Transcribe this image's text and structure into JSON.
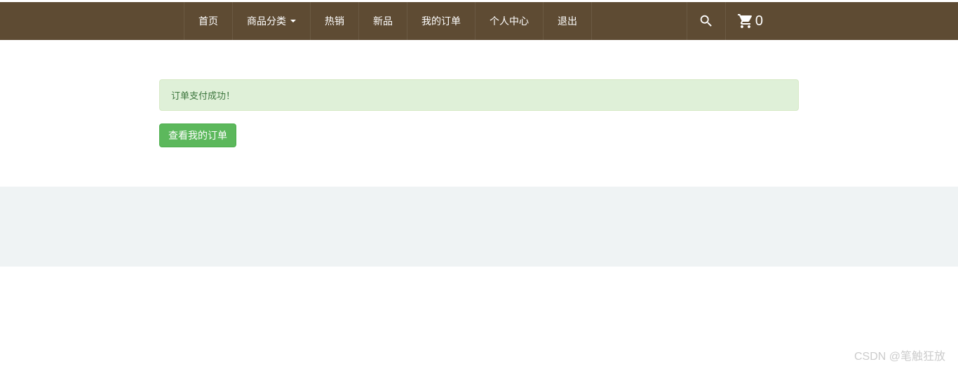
{
  "nav": {
    "items": [
      {
        "label": "首页"
      },
      {
        "label": "商品分类",
        "dropdown": true
      },
      {
        "label": "热销"
      },
      {
        "label": "新品"
      },
      {
        "label": "我的订单"
      },
      {
        "label": "个人中心"
      },
      {
        "label": "退出"
      }
    ],
    "cart_count": "0"
  },
  "alert": {
    "message": "订单支付成功！"
  },
  "button": {
    "view_orders": "查看我的订单"
  },
  "watermark": "CSDN @笔触狂放"
}
